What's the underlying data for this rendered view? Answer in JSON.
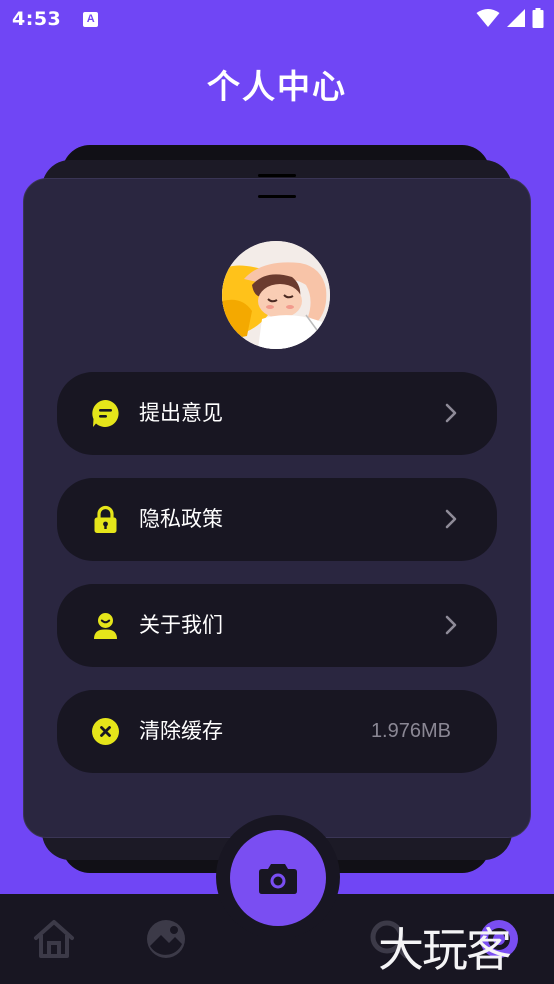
{
  "status_bar": {
    "time": "4:53",
    "notification_letter": "A"
  },
  "header": {
    "title": "个人中心"
  },
  "menu": {
    "items": [
      {
        "label": "提出意见",
        "icon": "feedback-icon"
      },
      {
        "label": "隐私政策",
        "icon": "lock-icon"
      },
      {
        "label": "关于我们",
        "icon": "user-icon"
      },
      {
        "label": "清除缓存",
        "icon": "clear-icon",
        "value": "1.976MB"
      }
    ]
  },
  "bottom_nav": {
    "items": [
      "home-icon",
      "gallery-icon",
      "camera-icon",
      "search-icon",
      "profile-icon"
    ]
  },
  "watermark": "大玩客",
  "colors": {
    "background": "#7046f5",
    "card": "#2a2640",
    "item": "#181622",
    "accent": "#e5e51a",
    "camera": "#7a4ef2"
  }
}
